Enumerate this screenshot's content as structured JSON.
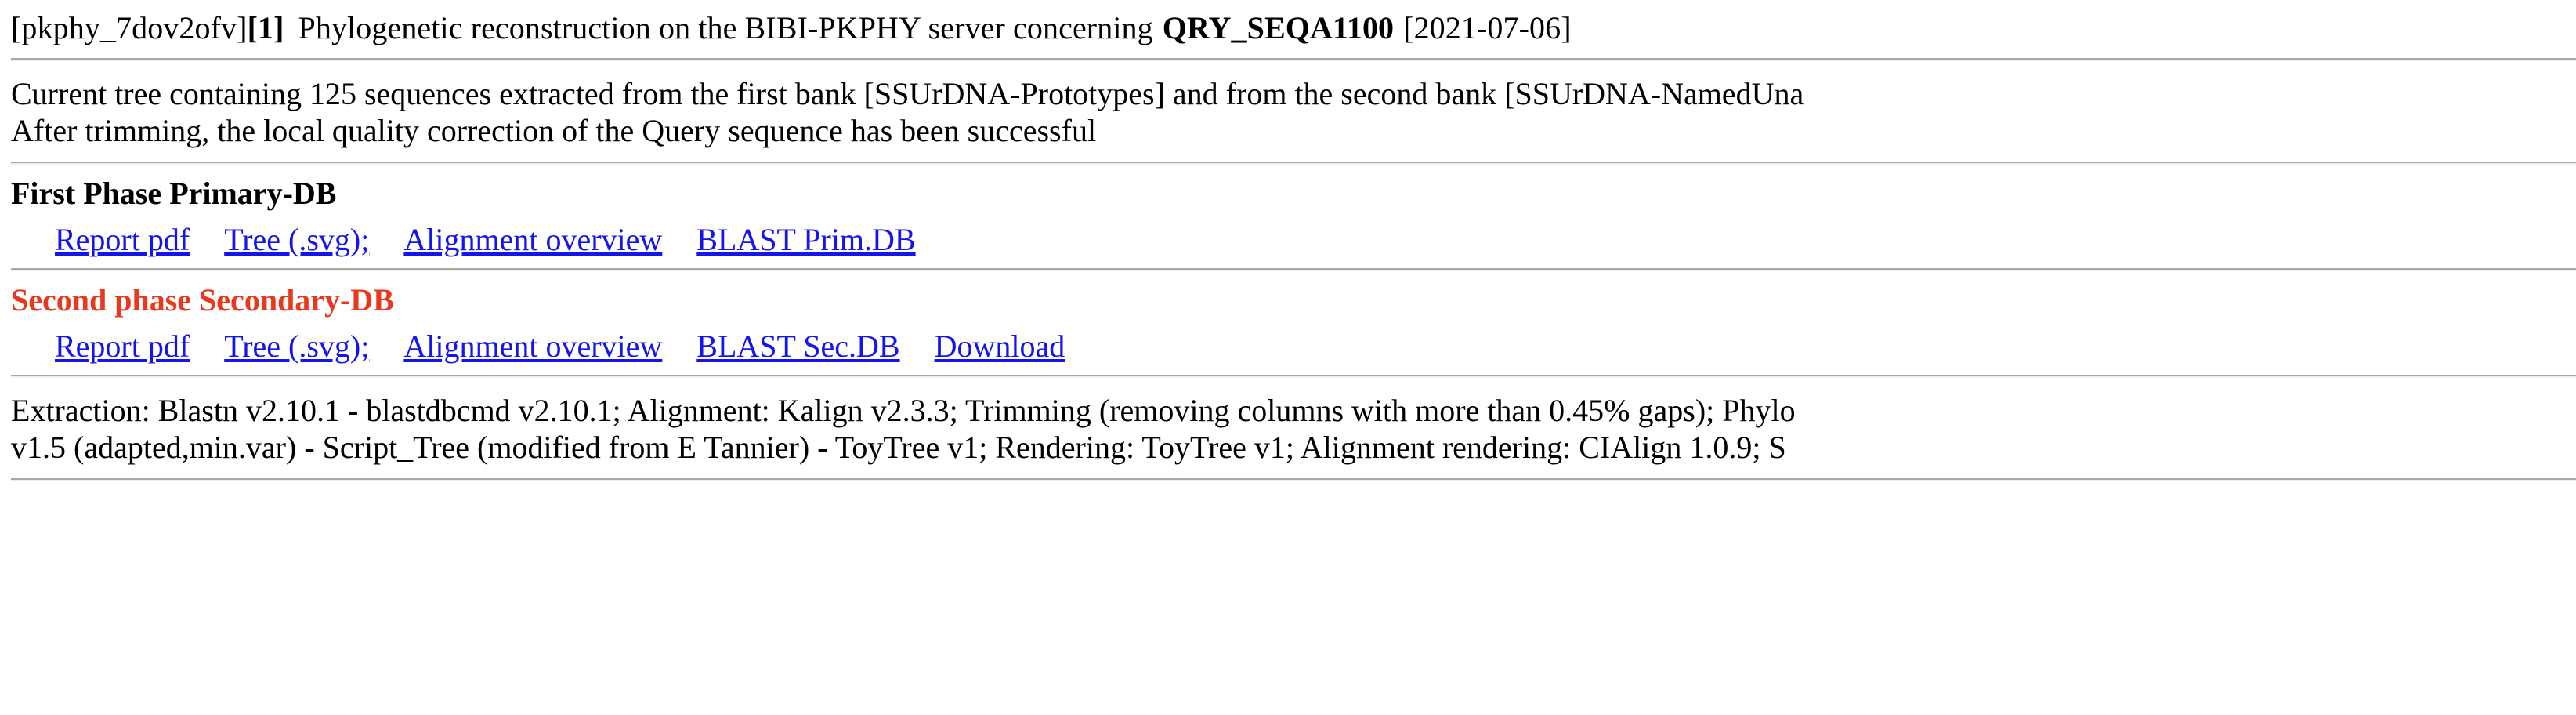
{
  "header": {
    "job_id": "[pkphy_7dov2ofv]",
    "job_index": "[1]",
    "title_text": "Phylogenetic reconstruction on the BIBI-PKPHY server concerning",
    "query_name": "QRY_SEQA1100",
    "run_date": "[2021-07-06]"
  },
  "status": {
    "line1": "Current tree containing 125 sequences extracted from the first bank [SSUrDNA-Prototypes] and from the second bank [SSUrDNA-NamedUna",
    "line2": "After trimming, the local quality correction of the Query sequence has been successful",
    "sequence_count": "125",
    "first_bank": "SSUrDNA-Prototypes",
    "second_bank": "SSUrDNA-NamedUna"
  },
  "phases": [
    {
      "heading": "First Phase Primary-DB",
      "heading_color": "#000000",
      "links": [
        "Report pdf",
        "Tree (.svg);",
        "Alignment overview",
        "BLAST Prim.DB"
      ]
    },
    {
      "heading": "Second phase Secondary-DB",
      "heading_color": "#e8391f",
      "links": [
        "Report pdf",
        "Tree (.svg);",
        "Alignment overview",
        "BLAST Sec.DB",
        "Download"
      ]
    }
  ],
  "methods": {
    "line1": "Extraction: Blastn v2.10.1 - blastdbcmd v2.10.1; Alignment: Kalign v2.3.3; Trimming (removing columns with more than 0.45% gaps); Phylo",
    "line2": "v1.5 (adapted,min.var) - Script_Tree (modified from E Tannier) - ToyTree v1; Rendering: ToyTree v1; Alignment rendering: CIAlign 1.0.9; S"
  },
  "colors": {
    "link": "#1414ee",
    "secondary_heading": "#e8391f",
    "text": "#000000",
    "background": "#ffffff",
    "rule_dark": "#a8a8a8",
    "rule_light": "#eeeeee"
  }
}
